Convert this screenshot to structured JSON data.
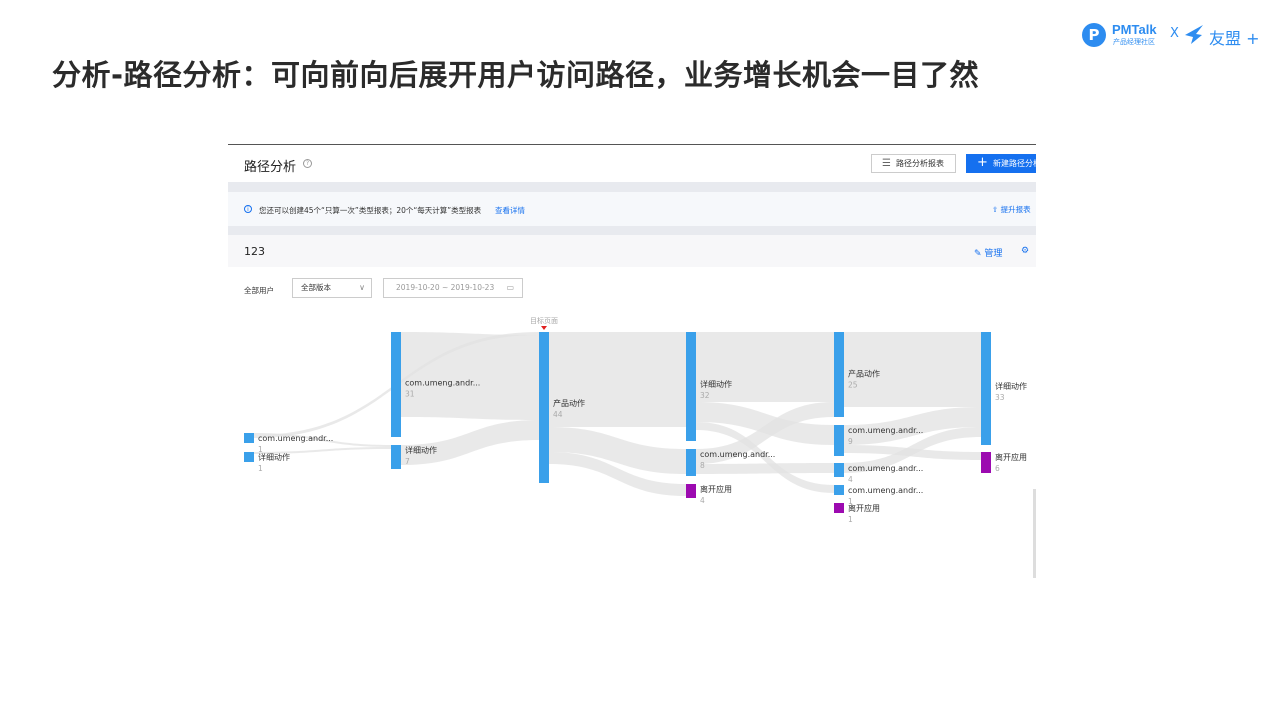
{
  "slide": {
    "title": "分析-路径分析：可向前向后展开用户访问路径，业务增长机会一目了然"
  },
  "brand": {
    "pm_badge": "P",
    "pm_name": "PMTalk",
    "pm_sub": "产品经理社区",
    "x": "X",
    "ym_name": "友盟 +",
    "color": "#2d8cf0"
  },
  "app": {
    "page_name": "路径分析",
    "help": "?",
    "report_button": "路径分析报表",
    "new_button": "新建路径分析",
    "notice": {
      "icon": "i",
      "text": "您还可以创建45个“只算一次”类型报表；20个“每天计算”类型报表",
      "link": "查看详情",
      "upgrade": "⇧ 提升报表"
    },
    "report_name": "123",
    "manage": "✎ 管理",
    "settings": "⚙",
    "filters": {
      "user": "全部用户",
      "version": "全部版本",
      "date_range": "2019-10-20  ~  2019-10-23"
    },
    "target_label": "目标页面",
    "accent": "#1570ef"
  },
  "sankey": {
    "node_color": "#3aa0ea",
    "exit_color": "#9c0ab0",
    "link_color": "#e2e2e2",
    "columns": [
      [
        {
          "label": "com.umeng.andr...",
          "value": 1
        },
        {
          "label": "详细动作",
          "value": 1
        }
      ],
      [
        {
          "label": "com.umeng.andr...",
          "value": 31
        },
        {
          "label": "详细动作",
          "value": 7
        }
      ],
      [
        {
          "label": "产品动作",
          "value": 44,
          "target": true
        }
      ],
      [
        {
          "label": "详细动作",
          "value": 32
        },
        {
          "label": "com.umeng.andr...",
          "value": 8
        },
        {
          "label": "离开应用",
          "value": 4,
          "exit": true
        }
      ],
      [
        {
          "label": "产品动作",
          "value": 25
        },
        {
          "label": "com.umeng.andr...",
          "value": 9
        },
        {
          "label": "com.umeng.andr...",
          "value": 4
        },
        {
          "label": "com.umeng.andr...",
          "value": 1
        },
        {
          "label": "离开应用",
          "value": 1,
          "exit": true
        }
      ],
      [
        {
          "label": "详细动作",
          "value": 33
        },
        {
          "label": "离开应用",
          "value": 6,
          "exit": true
        }
      ]
    ]
  }
}
